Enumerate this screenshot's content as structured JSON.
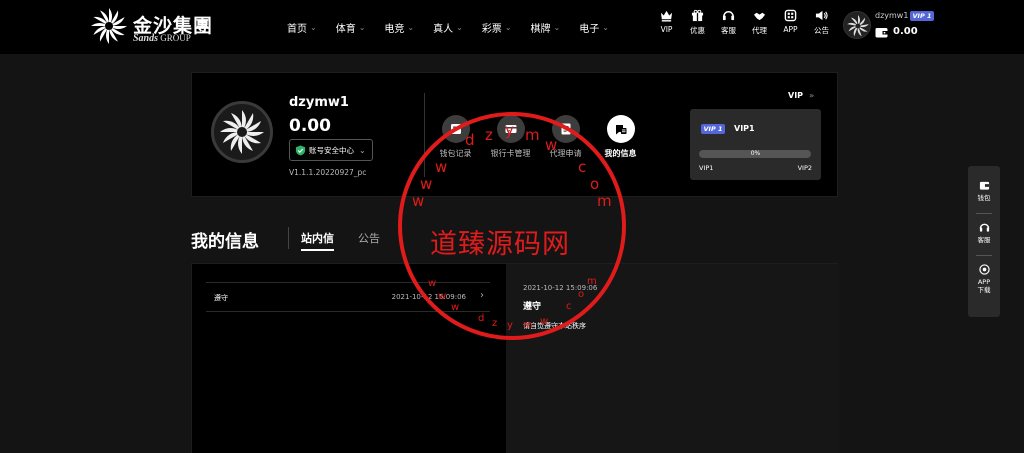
{
  "brand": {
    "name_cn": "金沙集團",
    "name_en_mark": "Sands",
    "name_en_rest": "GROUP"
  },
  "nav": {
    "items": [
      {
        "label": "首页"
      },
      {
        "label": "体育"
      },
      {
        "label": "电竞"
      },
      {
        "label": "真人"
      },
      {
        "label": "彩票"
      },
      {
        "label": "棋牌"
      },
      {
        "label": "电子"
      }
    ],
    "quick": [
      {
        "label": "VIP",
        "icon": "crown-icon"
      },
      {
        "label": "优惠",
        "icon": "gift-icon"
      },
      {
        "label": "客服",
        "icon": "headset-icon"
      },
      {
        "label": "代理",
        "icon": "handshake-icon"
      },
      {
        "label": "APP",
        "icon": "app-icon"
      },
      {
        "label": "公告",
        "icon": "speaker-icon"
      }
    ],
    "user": {
      "name": "dzymw1",
      "vip": "VIP 1",
      "balance": "0.00"
    }
  },
  "profile": {
    "username": "dzymw1",
    "balance": "0.00",
    "security_label": "账号安全中心",
    "version": "V1.1.1.20220927_pc",
    "actions": [
      {
        "label": "钱包记录",
        "icon": "wallet-record-icon"
      },
      {
        "label": "银行卡管理",
        "icon": "bank-card-icon"
      },
      {
        "label": "代理申请",
        "icon": "agent-apply-icon"
      },
      {
        "label": "我的信息",
        "icon": "message-icon"
      }
    ],
    "vip": {
      "link_label": "VIP",
      "badge": "VIP 1",
      "level": "VIP1",
      "progress_text": "0%",
      "progress": 0,
      "from": "VIP1",
      "to": "VIP2"
    }
  },
  "section": {
    "title": "我的信息",
    "tabs": [
      {
        "label": "站内信"
      },
      {
        "label": "公告"
      }
    ]
  },
  "messages": {
    "list": [
      {
        "title": "遵守",
        "date": "2021-10-12 15:09:06"
      }
    ],
    "detail": {
      "date": "2021-10-12 15:09:06",
      "title": "遵守",
      "body": "请自觉遵守本站秩序"
    }
  },
  "sidefloat": [
    {
      "label": "钱包",
      "icon": "wallet-icon"
    },
    {
      "label": "客服",
      "icon": "headset-icon"
    },
    {
      "label": "APP下载",
      "icon": "download-icon"
    }
  ],
  "watermark": {
    "text": "道臻源码网",
    "chars": [
      "w",
      "w",
      "w",
      "d",
      "z",
      "y",
      "m",
      "w",
      "c",
      "o",
      "m"
    ],
    "small_chars": [
      "w",
      "w",
      "w",
      "d",
      "z",
      "y",
      "m",
      "w",
      "c",
      "o",
      "m"
    ]
  },
  "colors": {
    "accent_vip": "#5566d8",
    "watermark": "#e01b1b",
    "shield_green": "#2fb36b"
  }
}
